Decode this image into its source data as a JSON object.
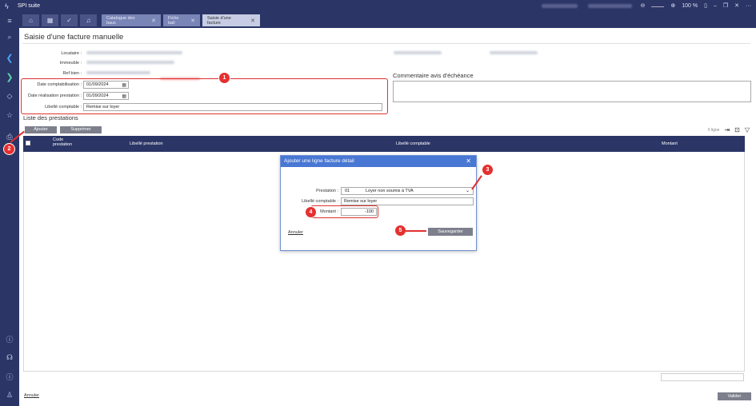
{
  "app": {
    "title": "SPI suite"
  },
  "titlebar": {
    "zoom": "100 %"
  },
  "tabs": [
    {
      "label": "Catalogue des baux"
    },
    {
      "label": "Fiche bail"
    },
    {
      "label": "Saisie d'une facture"
    }
  ],
  "page": {
    "title": "Saisie d'une facture manuelle"
  },
  "form": {
    "locataire_label": "Locataire :",
    "immeuble_label": "Immeuble :",
    "ref_bien_label": "Ref bien :",
    "date_compta_label": "Date comptabilisation :",
    "date_compta_value": "01/09/2024",
    "date_real_label": "Date réalisation prestation :",
    "date_real_value": "01/09/2024",
    "libelle_label": "Libellé comptable :",
    "libelle_value": "Remise sur loyer"
  },
  "comment": {
    "title": "Commentaire avis d'échéance"
  },
  "prestations": {
    "title": "Liste des prestations",
    "add_label": "Ajouter",
    "delete_label": "Supprimer",
    "count": "0 ligne",
    "columns": [
      "Code prestation",
      "Libellé prestation",
      "Libellé comptable",
      "Montant"
    ]
  },
  "modal": {
    "title": "Ajouter une ligne facture détail",
    "prestation_label": "Prestation :",
    "prestation_code": "01",
    "prestation_value": "Loyer non soumis à TVA",
    "libelle_label": "Libellé comptable :",
    "libelle_value": "Remise sur loyer",
    "montant_label": "Montant :",
    "montant_value": "-100",
    "cancel_label": "Annuler",
    "save_label": "Sauvegarder"
  },
  "footer": {
    "cancel_label": "Annuler",
    "validate_label": "Valider"
  },
  "callouts": [
    "1",
    "2",
    "3",
    "4",
    "5"
  ],
  "colors": {
    "navy": "#2b3566",
    "callout_red": "#e53030",
    "modal_blue": "#4877d4"
  }
}
